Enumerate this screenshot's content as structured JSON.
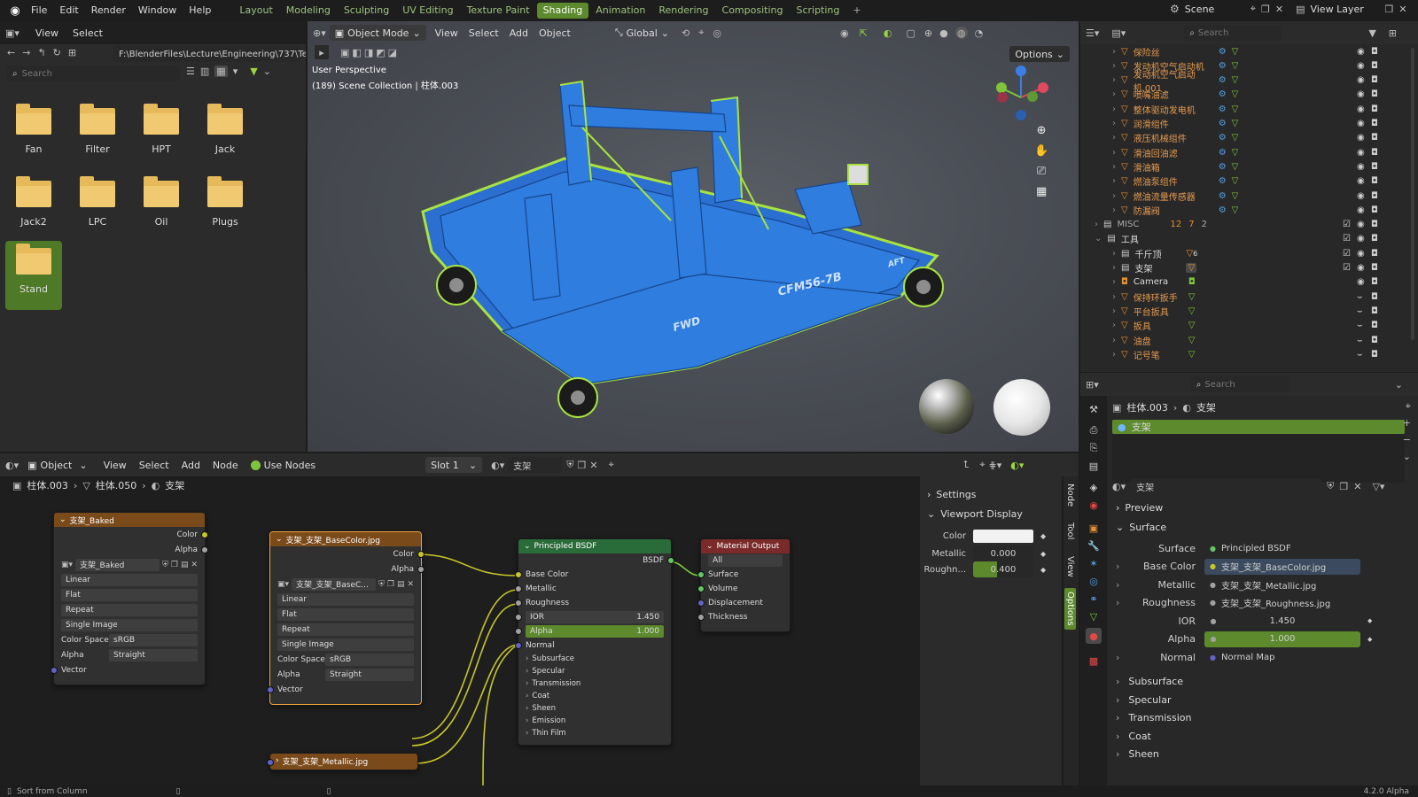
{
  "topbar": {
    "menus": [
      "File",
      "Edit",
      "Render",
      "Window",
      "Help"
    ],
    "workspaces": [
      "Layout",
      "Modeling",
      "Sculpting",
      "UV Editing",
      "Texture Paint",
      "Shading",
      "Animation",
      "Rendering",
      "Compositing",
      "Scripting"
    ],
    "active_workspace": "Shading",
    "scene": "Scene",
    "view_layer": "View Layer"
  },
  "filebrowser": {
    "menus": [
      "View",
      "Select"
    ],
    "path": "F:\\BlenderFiles\\Lecture\\Engineering\\737\\Te...",
    "search_placeholder": "Search",
    "folders": [
      "Fan",
      "Filter",
      "HPT",
      "Jack",
      "Jack2",
      "LPC",
      "Oil",
      "Plugs",
      "Stand"
    ],
    "selected": "Stand"
  },
  "viewport": {
    "mode": "Object Mode",
    "menus": [
      "View",
      "Select",
      "Add",
      "Object"
    ],
    "transform": "Global",
    "options": "Options",
    "perspective": "User Perspective",
    "collection": "(189) Scene Collection | 柱体.003",
    "model_text": "CFM56-7B",
    "fwd_text": "FWD",
    "aft_text": "AFT"
  },
  "outliner": {
    "search_placeholder": "Search",
    "items": [
      "保险丝",
      "发动机空气启动机",
      "发动机空气启动机.001",
      "喷嘴油滤",
      "整体驱动发电机",
      "润滑组件",
      "液压机械组件",
      "滑油回油滤",
      "滑油箱",
      "燃油泵组件",
      "燃油流量传感器",
      "防漏阀"
    ],
    "misc": "MISC",
    "misc_count1": "12",
    "misc_count2": "7",
    "misc_count3": "2",
    "tools": "工具",
    "tool_items": [
      "千斤顶",
      "支架",
      "Camera",
      "保持环扳手",
      "平台扳具",
      "扳具",
      "油盘",
      "记号笔"
    ],
    "tool_badge": "6"
  },
  "nodeeditor": {
    "object": "Object",
    "menus": [
      "View",
      "Select",
      "Add",
      "Node"
    ],
    "use_nodes": "Use Nodes",
    "slot": "Slot 1",
    "material": "支架",
    "breadcrumb": [
      "柱体.003",
      "柱体.050",
      "支架"
    ],
    "node_baked": {
      "title": "支架_Baked",
      "out1": "Color",
      "out2": "Alpha",
      "image": "支架_Baked",
      "interp": "Linear",
      "proj": "Flat",
      "ext": "Repeat",
      "src": "Single Image",
      "cs_label": "Color Space",
      "cs": "sRGB",
      "alpha_label": "Alpha",
      "alpha": "Straight",
      "vector": "Vector"
    },
    "node_base": {
      "title": "支架_支架_BaseColor.jpg",
      "out1": "Color",
      "out2": "Alpha",
      "image": "支架_支架_BaseC...",
      "interp": "Linear",
      "proj": "Flat",
      "ext": "Repeat",
      "src": "Single Image",
      "cs_label": "Color Space",
      "cs": "sRGB",
      "alpha_label": "Alpha",
      "alpha": "Straight",
      "vector": "Vector"
    },
    "node_metal": {
      "title": "支架_支架_Metallic.jpg"
    },
    "node_bsdf": {
      "title": "Principled BSDF",
      "out": "BSDF",
      "base": "Base Color",
      "metallic": "Metallic",
      "rough": "Roughness",
      "ior": "IOR",
      "ior_val": "1.450",
      "alpha": "Alpha",
      "alpha_val": "1.000",
      "normal": "Normal",
      "subs": [
        "Subsurface",
        "Specular",
        "Transmission",
        "Coat",
        "Sheen",
        "Emission",
        "Thin Film"
      ]
    },
    "node_out": {
      "title": "Material Output",
      "target": "All",
      "inputs": [
        "Surface",
        "Volume",
        "Displacement",
        "Thickness"
      ]
    },
    "sidebar": {
      "settings": "Settings",
      "vd": "Viewport Display",
      "color": "Color",
      "metallic": "Metallic",
      "metallic_val": "0.000",
      "rough": "Roughn...",
      "rough_val": "0.400",
      "tabs": [
        "Node",
        "Tool",
        "View",
        "Options"
      ]
    }
  },
  "properties": {
    "search_placeholder": "Search",
    "crumb1": "柱体.003",
    "crumb2": "支架",
    "slot_name": "支架",
    "material": "支架",
    "preview": "Preview",
    "surface": "Surface",
    "rows": [
      {
        "label": "Surface",
        "value": "Principled BSDF"
      },
      {
        "label": "Base Color",
        "value": "支架_支架_BaseColor.jpg"
      },
      {
        "label": "Metallic",
        "value": "支架_支架_Metallic.jpg"
      },
      {
        "label": "Roughness",
        "value": "支架_支架_Roughness.jpg"
      },
      {
        "label": "IOR",
        "value": "1.450"
      },
      {
        "label": "Alpha",
        "value": "1.000"
      },
      {
        "label": "Normal",
        "value": "Normal Map"
      }
    ],
    "sections": [
      "Subsurface",
      "Specular",
      "Transmission",
      "Coat",
      "Sheen"
    ]
  },
  "statusbar": {
    "left": "Sort from Column",
    "version": "4.2.0 Alpha"
  },
  "colors": {
    "accent": "#5c8a2c",
    "outline": "#9bd63c",
    "frame": "#2b6fd1",
    "bg_viewport": "#4a4e55"
  }
}
